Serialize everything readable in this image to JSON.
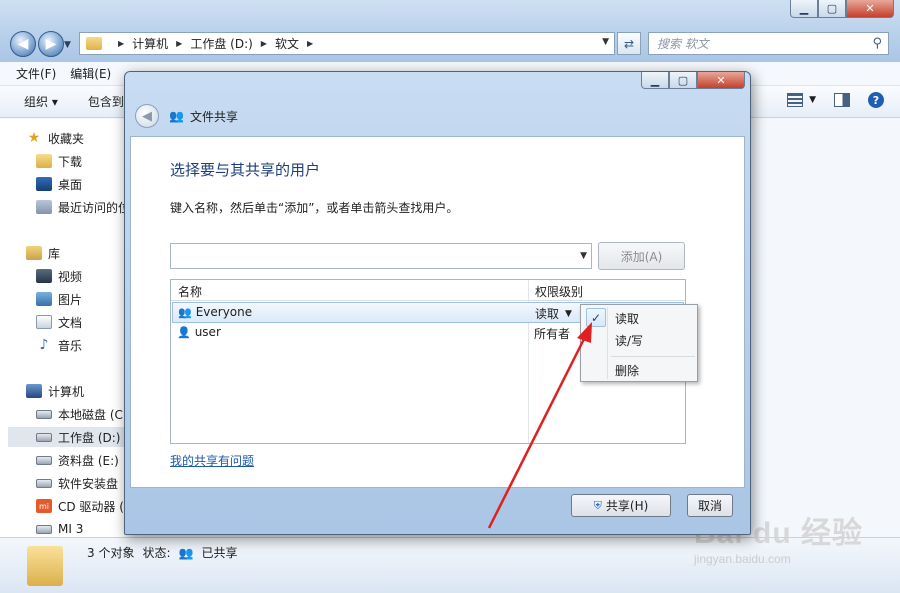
{
  "explorer": {
    "address": {
      "crumbs": [
        "计算机",
        "工作盘 (D:)",
        "软文"
      ]
    },
    "search": {
      "placeholder": "搜索 软文"
    },
    "menu": [
      "文件(F)",
      "编辑(E)"
    ],
    "toolbar": {
      "organize": "组织 ▾",
      "include": "包含到"
    },
    "sidebar": {
      "favorites": "收藏夹",
      "downloads": "下载",
      "desktop": "桌面",
      "recent": "最近访问的位置",
      "libraries": "库",
      "videos": "视频",
      "pictures": "图片",
      "documents": "文档",
      "music": "音乐",
      "computer": "计算机",
      "drive_c": "本地磁盘 (C:)",
      "drive_d": "工作盘 (D:)",
      "drive_e": "资料盘 (E:)",
      "drive_f": "软件安装盘",
      "cd": "CD 驱动器 (",
      "mi": "MI 3"
    },
    "status": {
      "count": "3 个对象",
      "state_label": "状态:",
      "state_value": "已共享"
    }
  },
  "dialog": {
    "window_title": "文件共享",
    "heading": "选择要与其共享的用户",
    "description": "键入名称，然后单击“添加”，或者单击箭头查找用户。",
    "add_button": "添加(A)",
    "columns": {
      "name": "名称",
      "permission": "权限级别"
    },
    "rows": [
      {
        "name": "Everyone",
        "permission": "读取"
      },
      {
        "name": "user",
        "permission": "所有者"
      }
    ],
    "trouble_link": "我的共享有问题",
    "share_button": "共享(H)",
    "cancel_button": "取消"
  },
  "context_menu": {
    "items": [
      "读取",
      "读/写",
      "删除"
    ],
    "checked": "✓"
  },
  "watermark": {
    "main": "Bai du 经验",
    "sub": "jingyan.baidu.com"
  },
  "colors": {
    "accent": "#1e3f7a",
    "arrow": "#e02020",
    "link": "#1b5aa8"
  }
}
